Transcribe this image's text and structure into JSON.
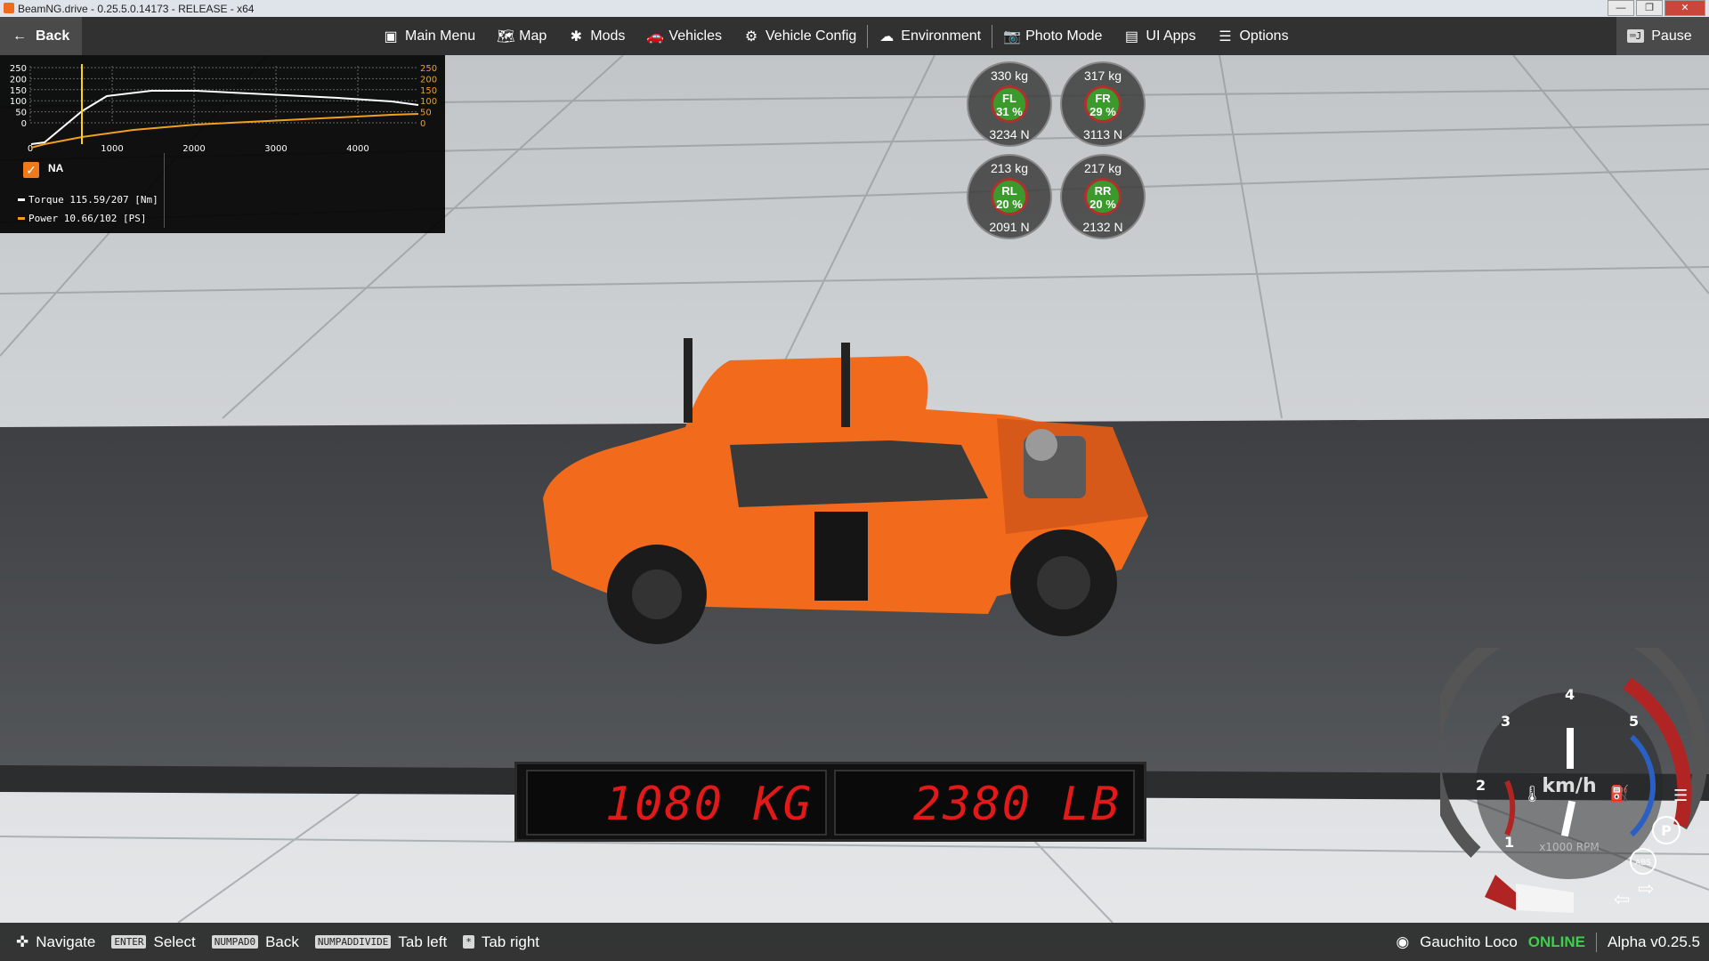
{
  "window": {
    "title": "BeamNG.drive - 0.25.5.0.14173 - RELEASE - x64",
    "controls": [
      "—",
      "❐",
      "✕"
    ]
  },
  "topbar": {
    "back_label": "Back",
    "menu": [
      {
        "icon": "main-menu-icon",
        "glyph": "▣",
        "label": "Main Menu"
      },
      {
        "icon": "map-icon",
        "glyph": "🗺",
        "label": "Map"
      },
      {
        "icon": "mods-icon",
        "glyph": "✱",
        "label": "Mods"
      },
      {
        "icon": "vehicles-icon",
        "glyph": "🚗",
        "label": "Vehicles"
      },
      {
        "icon": "vehicle-config-icon",
        "glyph": "⚙",
        "label": "Vehicle Config"
      },
      {
        "icon": "environment-icon",
        "glyph": "☁",
        "label": "Environment"
      },
      {
        "icon": "photo-mode-icon",
        "glyph": "📷",
        "label": "Photo Mode"
      },
      {
        "icon": "ui-apps-icon",
        "glyph": "▤",
        "label": "UI Apps"
      },
      {
        "icon": "options-icon",
        "glyph": "☰",
        "label": "Options"
      }
    ],
    "pause_label": "Pause"
  },
  "torque_graph": {
    "y_ticks_left": [
      "250",
      "200",
      "150",
      "100",
      "50",
      "0"
    ],
    "y_ticks_right": [
      "250",
      "200",
      "150",
      "100",
      "50",
      "0"
    ],
    "x_ticks": [
      "0",
      "1000",
      "2000",
      "3000",
      "4000"
    ],
    "checkbox_label": "NA",
    "torque_label": "Torque 115.59/207 [Nm]",
    "power_label": "Power 10.66/102  [PS]",
    "torque_color": "#ffffff",
    "power_color": "#f0a020"
  },
  "wheels": [
    {
      "id": "FL",
      "kg": "330 kg",
      "pct": "31 %",
      "n": "3234 N"
    },
    {
      "id": "FR",
      "kg": "317 kg",
      "pct": "29 %",
      "n": "3113 N"
    },
    {
      "id": "RL",
      "kg": "213 kg",
      "pct": "20 %",
      "n": "2091 N"
    },
    {
      "id": "RR",
      "kg": "217 kg",
      "pct": "20 %",
      "n": "2132 N"
    }
  ],
  "scale": {
    "kg": "1080 KG",
    "lb": "2380 LB"
  },
  "gauge": {
    "unit": "km/h",
    "rpm_label": "x1000 RPM",
    "ticks": [
      "1",
      "2",
      "3",
      "4",
      "5"
    ],
    "gear": "P",
    "abs": "ABS"
  },
  "bottombar": {
    "hints": [
      {
        "key": "",
        "label": "Navigate"
      },
      {
        "key": "ENTER",
        "label": "Select"
      },
      {
        "key": "NUMPAD0",
        "label": "Back"
      },
      {
        "key": "NUMPADDIVIDE",
        "label": "Tab left"
      },
      {
        "key": "*",
        "label": "Tab right"
      }
    ],
    "user": "Gauchito Loco",
    "status": "ONLINE",
    "version": "Alpha v0.25.5"
  },
  "colors": {
    "car": "#f26a1b",
    "accent": "#f07a1a",
    "online": "#3bd14a",
    "scale_digits": "#e11919"
  }
}
